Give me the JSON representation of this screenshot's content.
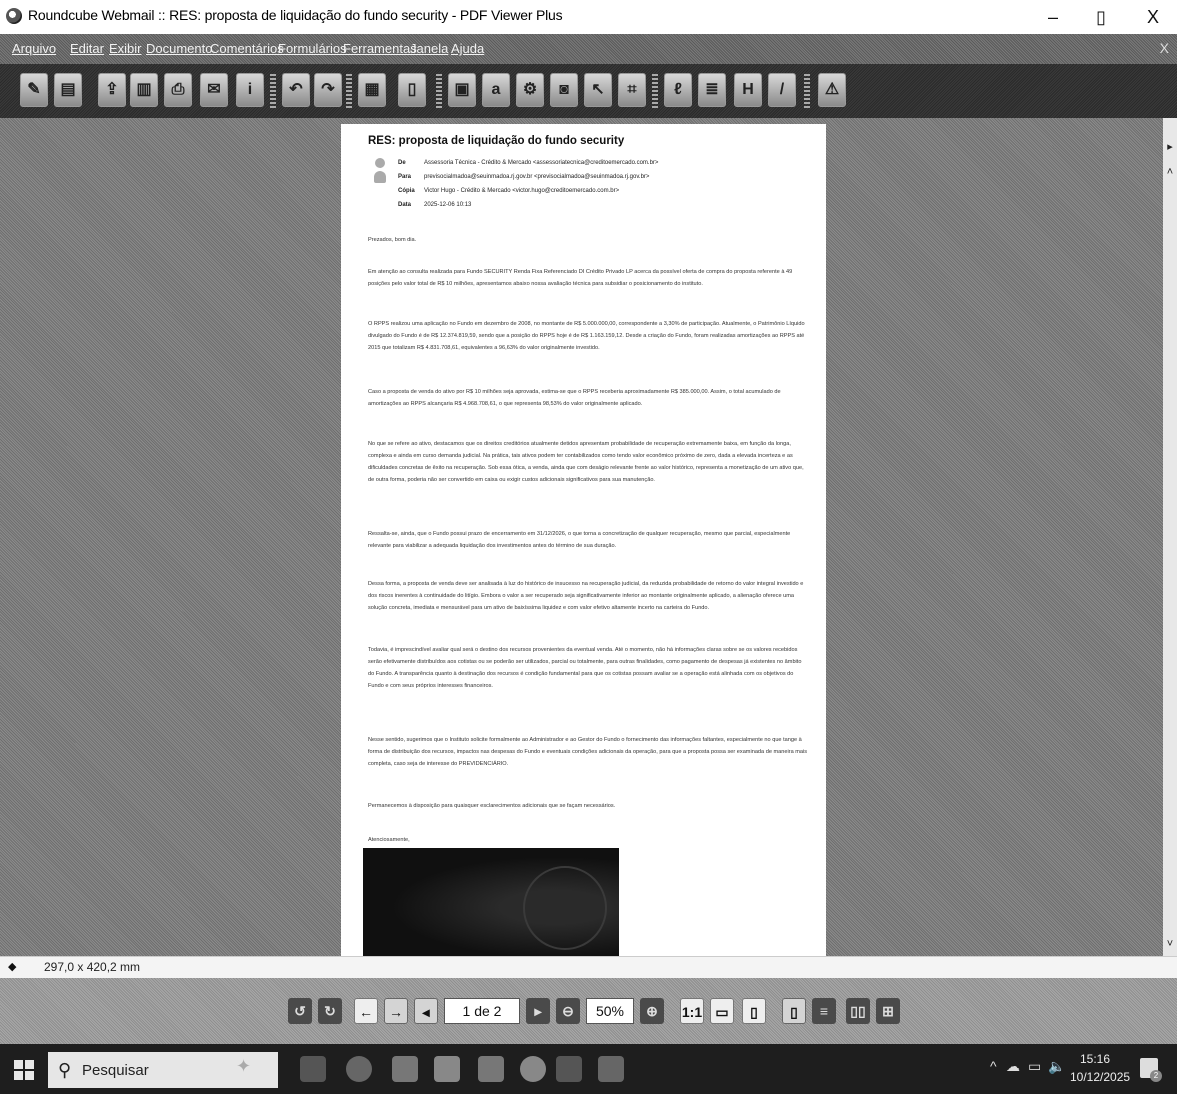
{
  "window": {
    "title": "Roundcube Webmail :: RES: proposta de liquidação do fundo security - PDF Viewer Plus",
    "minimize": "–",
    "maximize": "▯",
    "close": "X"
  },
  "menu": {
    "items": [
      "Arquivo",
      "Editar",
      "Exibir",
      "Documento",
      "Comentários",
      "Formulários",
      "Ferramentas",
      "Janela",
      "Ajuda"
    ],
    "close_doc": "X"
  },
  "toolbar": {
    "icons": [
      "new-document-icon",
      "pdf-icon",
      "open-icon",
      "copy-icon",
      "print-icon",
      "email-pdf-icon",
      "document-info-icon",
      "undo-icon",
      "redo-icon",
      "page-thumbnail-icon",
      "page-layout-icon",
      "select-tool-icon",
      "hand-tool-icon",
      "stamp-icon",
      "snapshot-icon",
      "cursor-icon",
      "crop-icon",
      "text-tool-icon",
      "note-icon",
      "highlight-icon",
      "pen-icon",
      "warning-icon"
    ]
  },
  "email": {
    "subject": "RES: proposta de liquidação do fundo security",
    "from_label": "De",
    "from_value": "Assessoria Técnica - Crédito & Mercado <assessoriatecnica@creditoemercado.com.br>",
    "to_label": "Para",
    "to_value": "previsocialmadoa@seuinmadoa.rj.gov.br <previsocialmadoa@seuinmadoa.rj.gov.br>",
    "cc_label": "Cópia",
    "cc_value": "Victor Hugo - Crédito & Mercado <victor.hugo@creditoemercado.com.br>",
    "date_label": "Data",
    "date_value": "2025-12-06 10:13",
    "greeting": "Prezados, bom dia.",
    "paragraphs": [
      "Em atenção ao consulta realizada para Fundo SECURITY Renda Fixa Referenciado DI Crédito Privado LP acerca da possível oferta de compra do proposta referente à 49 posições pelo valor total de R$ 10 milhões, apresentamos abaixo nossa avaliação técnica para subsidiar o posicionamento do instituto.",
      "O RPPS realizou uma aplicação no Fundo em dezembro de 2008, no montante de R$ 5.000.000,00, correspondente a 3,30% de participação. Atualmente, o Patrimônio Líquido divulgado do Fundo é de R$ 12.374.819,59, sendo que a posição do RPPS hoje é de R$ 1.163.159,12. Desde a criação do Fundo, foram realizadas amortizações ao RPPS até 2015 que totalizam R$ 4.831.708,61, equivalentes a 96,63% do valor originalmente investido.",
      "Caso a proposta de venda do ativo por R$ 10 milhões seja aprovada, estima-se que o RPPS receberia aproximadamente R$ 385.000,00. Assim, o total acumulado de amortizações ao RPPS alcançaria R$ 4.968.708,61, o que representa 98,53% do valor originalmente aplicado.",
      "No que se refere ao ativo, destacamos que os direitos creditórios atualmente detidos apresentam probabilidade de recuperação extremamente baixa, em função da longa, complexa e ainda em curso demanda judicial. Na prática, tais ativos podem ter contabilizados como tendo valor econômico próximo de zero, dada a elevada incerteza e as dificuldades concretas de êxito na recuperação. Sob essa ótica, a venda, ainda que com deságio relevante frente ao valor histórico, representa a monetização de um ativo que, de outra forma, poderia não ser convertido em caixa ou exigir custos adicionais significativos para sua manutenção.",
      "Ressalta-se, ainda, que o Fundo possui prazo de encerramento em 31/12/2026, o que torna a concretização de qualquer recuperação, mesmo que parcial, especialmente relevante para viabilizar a adequada liquidação dos investimentos antes do término de sua duração.",
      "Dessa forma, a proposta de venda deve ser analisada à luz do histórico de insucesso na recuperação judicial, da reduzida probabilidade de retorno do valor integral investido e dos riscos inerentes à continuidade do litígio. Embora o valor a ser recuperado seja significativamente inferior ao montante originalmente aplicado, a alienação oferece uma solução concreta, imediata e mensurável para um ativo de baixíssima liquidez e com valor efetivo altamente incerto na carteira do Fundo.",
      "Todavia, é imprescindível avaliar qual será o destino dos recursos provenientes da eventual venda. Até o momento, não há informações claras sobre se os valores recebidos serão efetivamente distribuídos aos cotistas ou se poderão ser utilizados, parcial ou totalmente, para outras finalidades, como pagamento de despesas já existentes no âmbito do Fundo. A transparência quanto à destinação dos recursos é condição fundamental para que os cotistas possam avaliar se a operação está alinhada com os objetivos do Fundo e com seus próprios interesses financeiros.",
      "Nesse sentido, sugerimos que o Instituto solicite formalmente ao Administrador e ao Gestor do Fundo o fornecimento das informações faltantes, especialmente no que tange à forma de distribuição dos recursos, impactos nas despesas do Fundo e eventuais condições adicionais da operação, para que a proposta possa ser examinada de maneira mais completa, caso seja de interesse do PREVIDENCIÁRIO.",
      "Permanecemos à disposição para quaisquer esclarecimentos adicionais que se façam necessários."
    ],
    "closing": "Atenciosamente,"
  },
  "statusbar": {
    "dimensions": "297,0 x 420,2 mm"
  },
  "navigation": {
    "page_indicator": "1 de 2",
    "zoom": "50%"
  },
  "taskbar": {
    "search_placeholder": "Pesquisar",
    "time": "15:16",
    "date": "10/12/2025",
    "notification_count": "2"
  }
}
